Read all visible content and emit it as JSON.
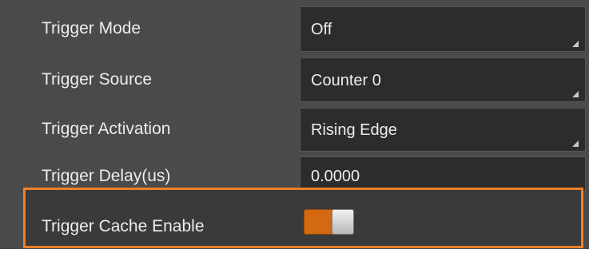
{
  "parameters": [
    {
      "label": "Trigger Mode",
      "value": "Off",
      "control": "dropdown"
    },
    {
      "label": "Trigger Source",
      "value": "Counter 0",
      "control": "dropdown"
    },
    {
      "label": "Trigger Activation",
      "value": "Rising Edge",
      "control": "dropdown"
    },
    {
      "label": "Trigger Delay(us)",
      "value": "0.0000",
      "control": "text-input"
    },
    {
      "label": "Trigger Cache Enable",
      "value": "on",
      "control": "toggle"
    }
  ],
  "colors": {
    "panel_background": "#4a4a4a",
    "field_background": "#2c2c2c",
    "highlight_border": "#f07f27",
    "toggle_on": "#d36a12"
  }
}
